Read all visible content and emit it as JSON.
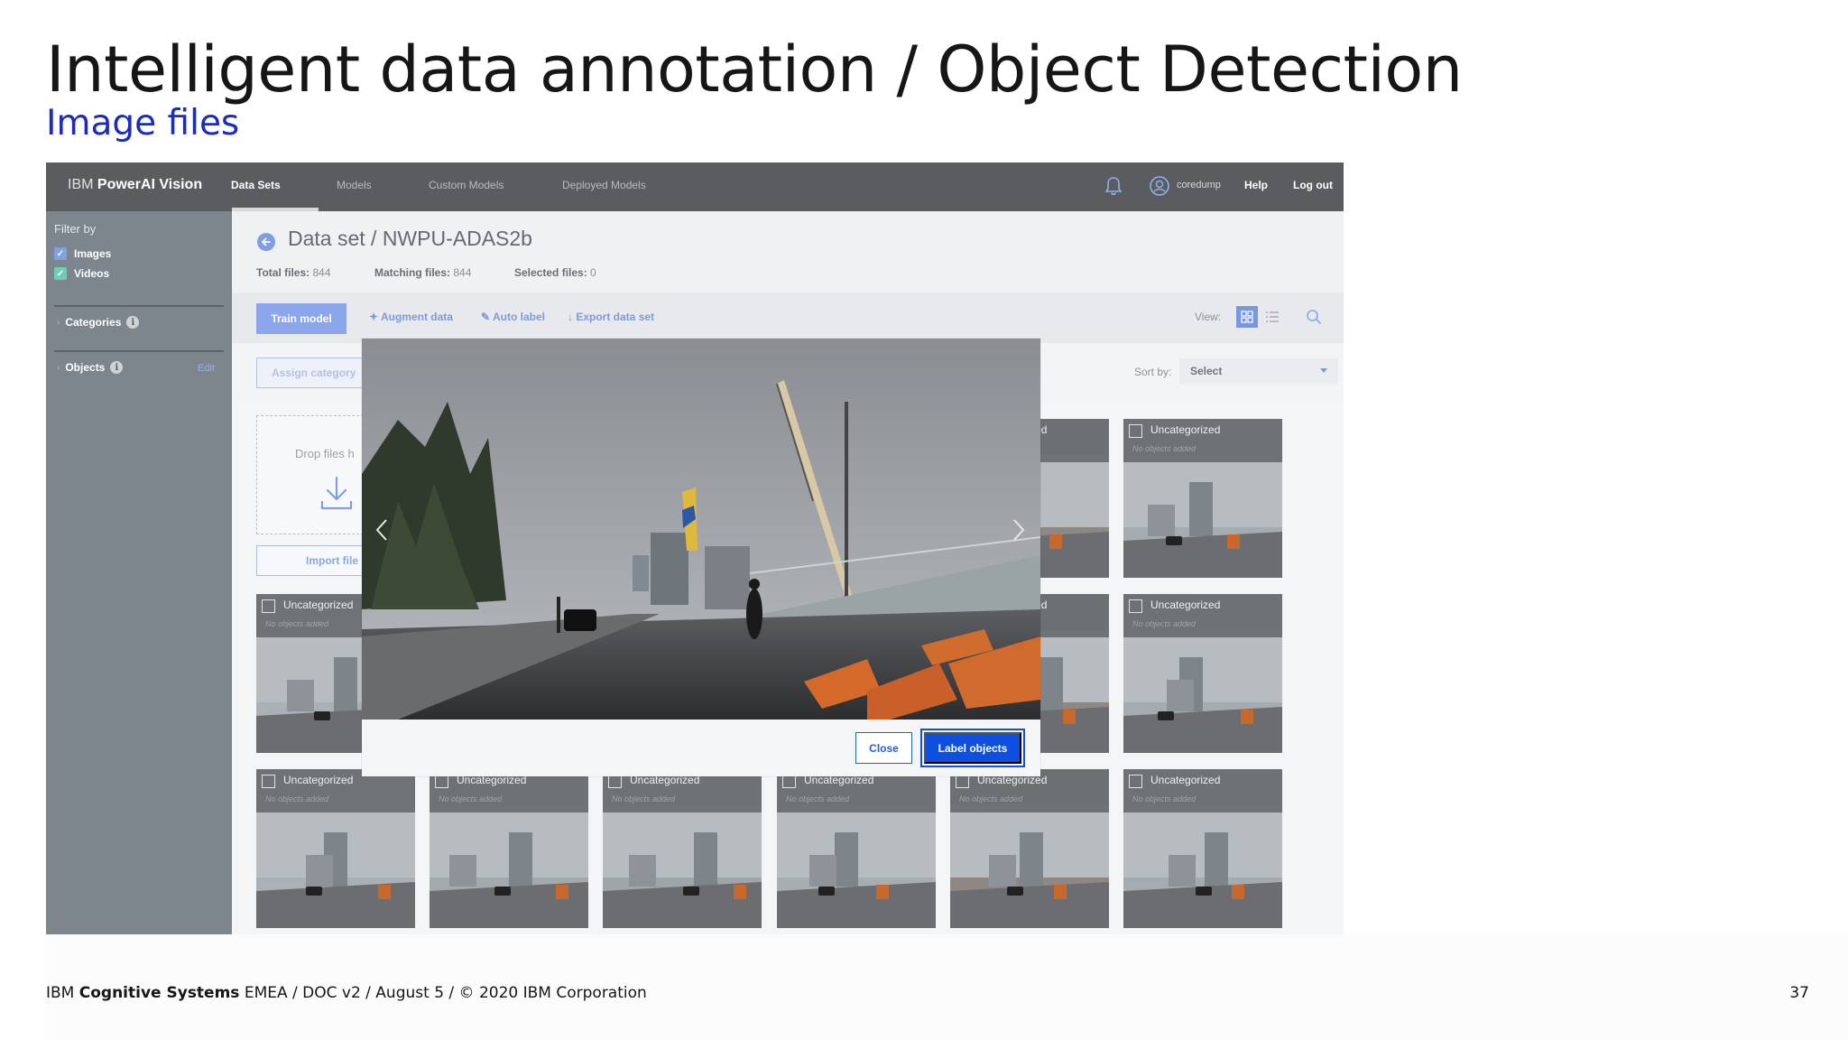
{
  "slide": {
    "title": "Intelligent data annotation / Object Detection",
    "subtitle": "Image files",
    "footer_brand": "IBM",
    "footer_brand_bold": "Cognitive Systems",
    "footer_rest": " EMEA / DOC v2 / August 5 / © 2020 IBM Corporation",
    "page_number": "37"
  },
  "app": {
    "brand_prefix": "IBM",
    "brand_name": "PowerAI Vision",
    "nav": [
      {
        "label": "Data Sets",
        "active": true
      },
      {
        "label": "Models",
        "active": false
      },
      {
        "label": "Custom Models",
        "active": false
      },
      {
        "label": "Deployed Models",
        "active": false
      }
    ],
    "username": "coredump",
    "help": "Help",
    "logout": "Log out",
    "icons": {
      "bell": "bell-icon",
      "user": "user-avatar-icon",
      "back": "back-arrow-icon",
      "search": "search-icon"
    }
  },
  "sidebar": {
    "filter_label": "Filter by",
    "filters": [
      {
        "label": "Images",
        "checked": true
      },
      {
        "label": "Videos",
        "checked": true
      }
    ],
    "categories_label": "Categories",
    "objects_label": "Objects",
    "edit_label": "Edit"
  },
  "dataset": {
    "title": "Data set / NWPU-ADAS2b",
    "total_label": "Total files:",
    "total_value": "844",
    "matching_label": "Matching files:",
    "matching_value": "844",
    "selected_label": "Selected files:",
    "selected_value": "0"
  },
  "toolbar": {
    "train": "Train model",
    "augment": "Augment data",
    "auto_label": "Auto label",
    "export": "Export data set",
    "view_label": "View:",
    "assign": "Assign category",
    "sort_label": "Sort by:",
    "sort_value": "Select"
  },
  "upload": {
    "drop_text": "Drop files h",
    "import": "Import file"
  },
  "thumbnails": {
    "category": "Uncategorized",
    "sub": "No objects added"
  },
  "modal": {
    "close": "Close",
    "label_objects": "Label objects"
  },
  "colors": {
    "accent": "#0f4fe0",
    "subtitle": "#1a2bbd",
    "topbar": "#5a5c60",
    "sidebar": "#7c868c"
  }
}
